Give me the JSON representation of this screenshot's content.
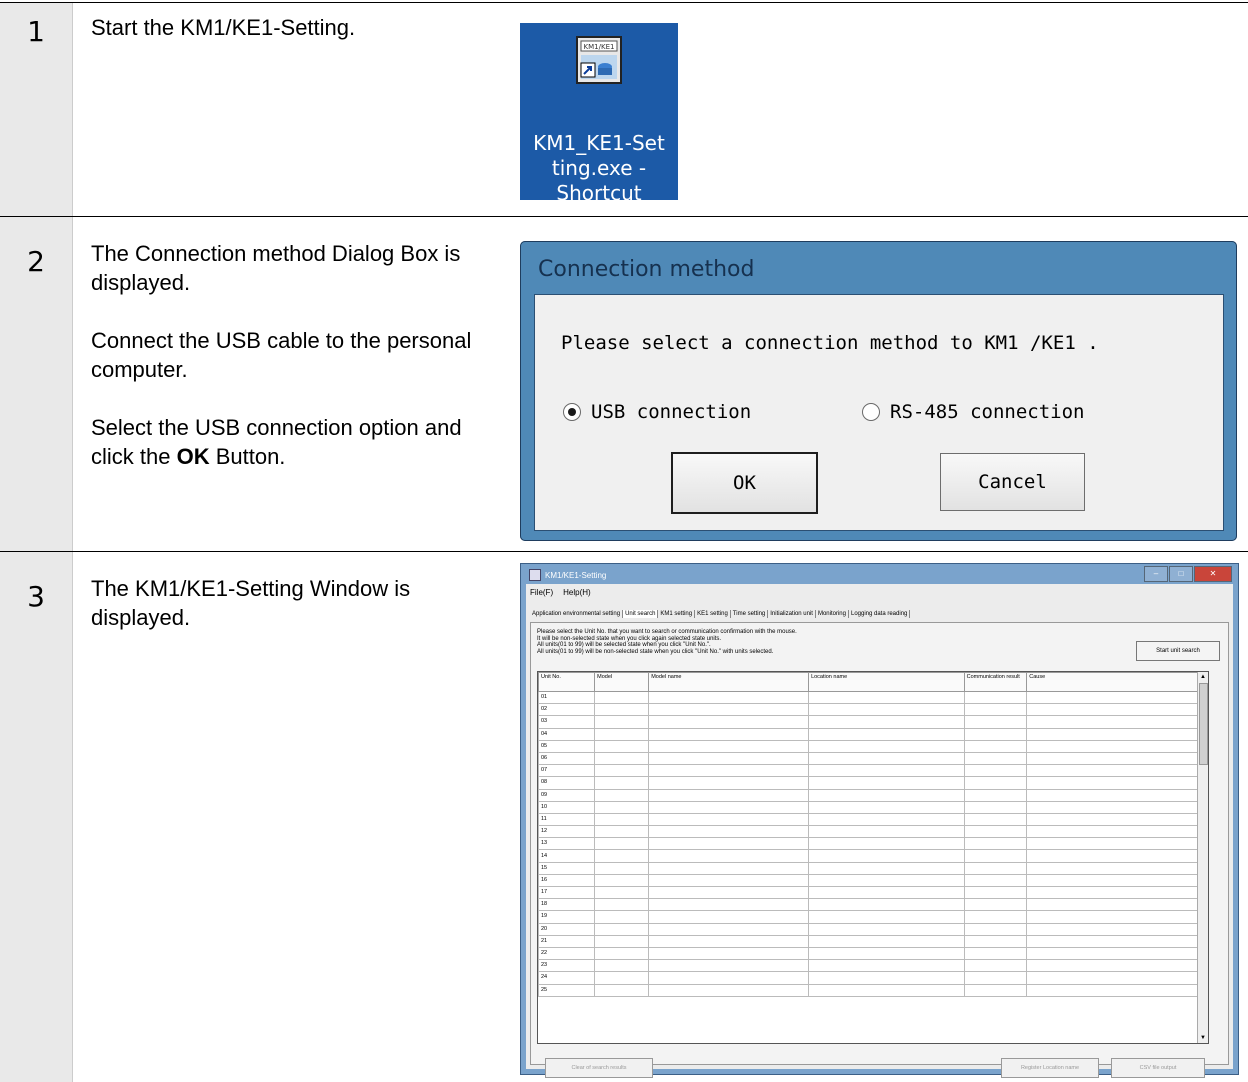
{
  "steps": [
    {
      "number": "1",
      "text": "Start the KM1/KE1-Setting."
    },
    {
      "number": "2",
      "text_lines": [
        "The Connection method Dialog Box is displayed.",
        "Connect the USB cable to the personal computer."
      ],
      "text_last_pre": "Select the USB connection option and click the ",
      "text_last_bold": "OK",
      "text_last_post": " Button."
    },
    {
      "number": "3",
      "text": "The KM1/KE1-Setting Window is displayed."
    }
  ],
  "shortcut": {
    "icon_caption": "KM1/KE1",
    "label_lines": [
      "KM1_KE1-Set",
      "ting.exe -",
      "Shortcut"
    ]
  },
  "dialog": {
    "title": "Connection method",
    "prompt": "Please select a connection method to KM1 /KE1 .",
    "options": [
      {
        "label": "USB connection",
        "selected": true
      },
      {
        "label": "RS-485 connection",
        "selected": false
      }
    ],
    "ok_label": "OK",
    "cancel_label": "Cancel"
  },
  "window": {
    "title": "KM1/KE1-Setting",
    "menu": [
      "File(F)",
      "Help(H)"
    ],
    "tabs": [
      "Application environmental setting",
      "Unit search",
      "KM1 setting",
      "KE1 setting",
      "Time setting",
      "Initialization unit",
      "Monitoring",
      "Logging data reading"
    ],
    "active_tab": "Unit search",
    "instructions": [
      "Please select the Unit No. that you want to search or communication confirmation with the mouse.",
      "It will be non-selected state when you click again selected state units.",
      "All units(01 to 99) will be selected state when you click \"Unit No.\".",
      "All units(01 to 99) will be non-selected state when you click \"Unit No.\" with units selected."
    ],
    "start_button": "Start unit search",
    "columns": [
      "Unit No.",
      "Model",
      "Model name",
      "Location name",
      "Communication result",
      "Cause"
    ],
    "rows": [
      "01",
      "02",
      "03",
      "04",
      "05",
      "06",
      "07",
      "08",
      "09",
      "10",
      "11",
      "12",
      "13",
      "14",
      "15",
      "16",
      "17",
      "18",
      "19",
      "20",
      "21",
      "22",
      "23",
      "24",
      "25"
    ],
    "bottom_buttons": {
      "clear": "Clear of search results",
      "register": "Register Location name",
      "csv": "CSV file output"
    }
  }
}
